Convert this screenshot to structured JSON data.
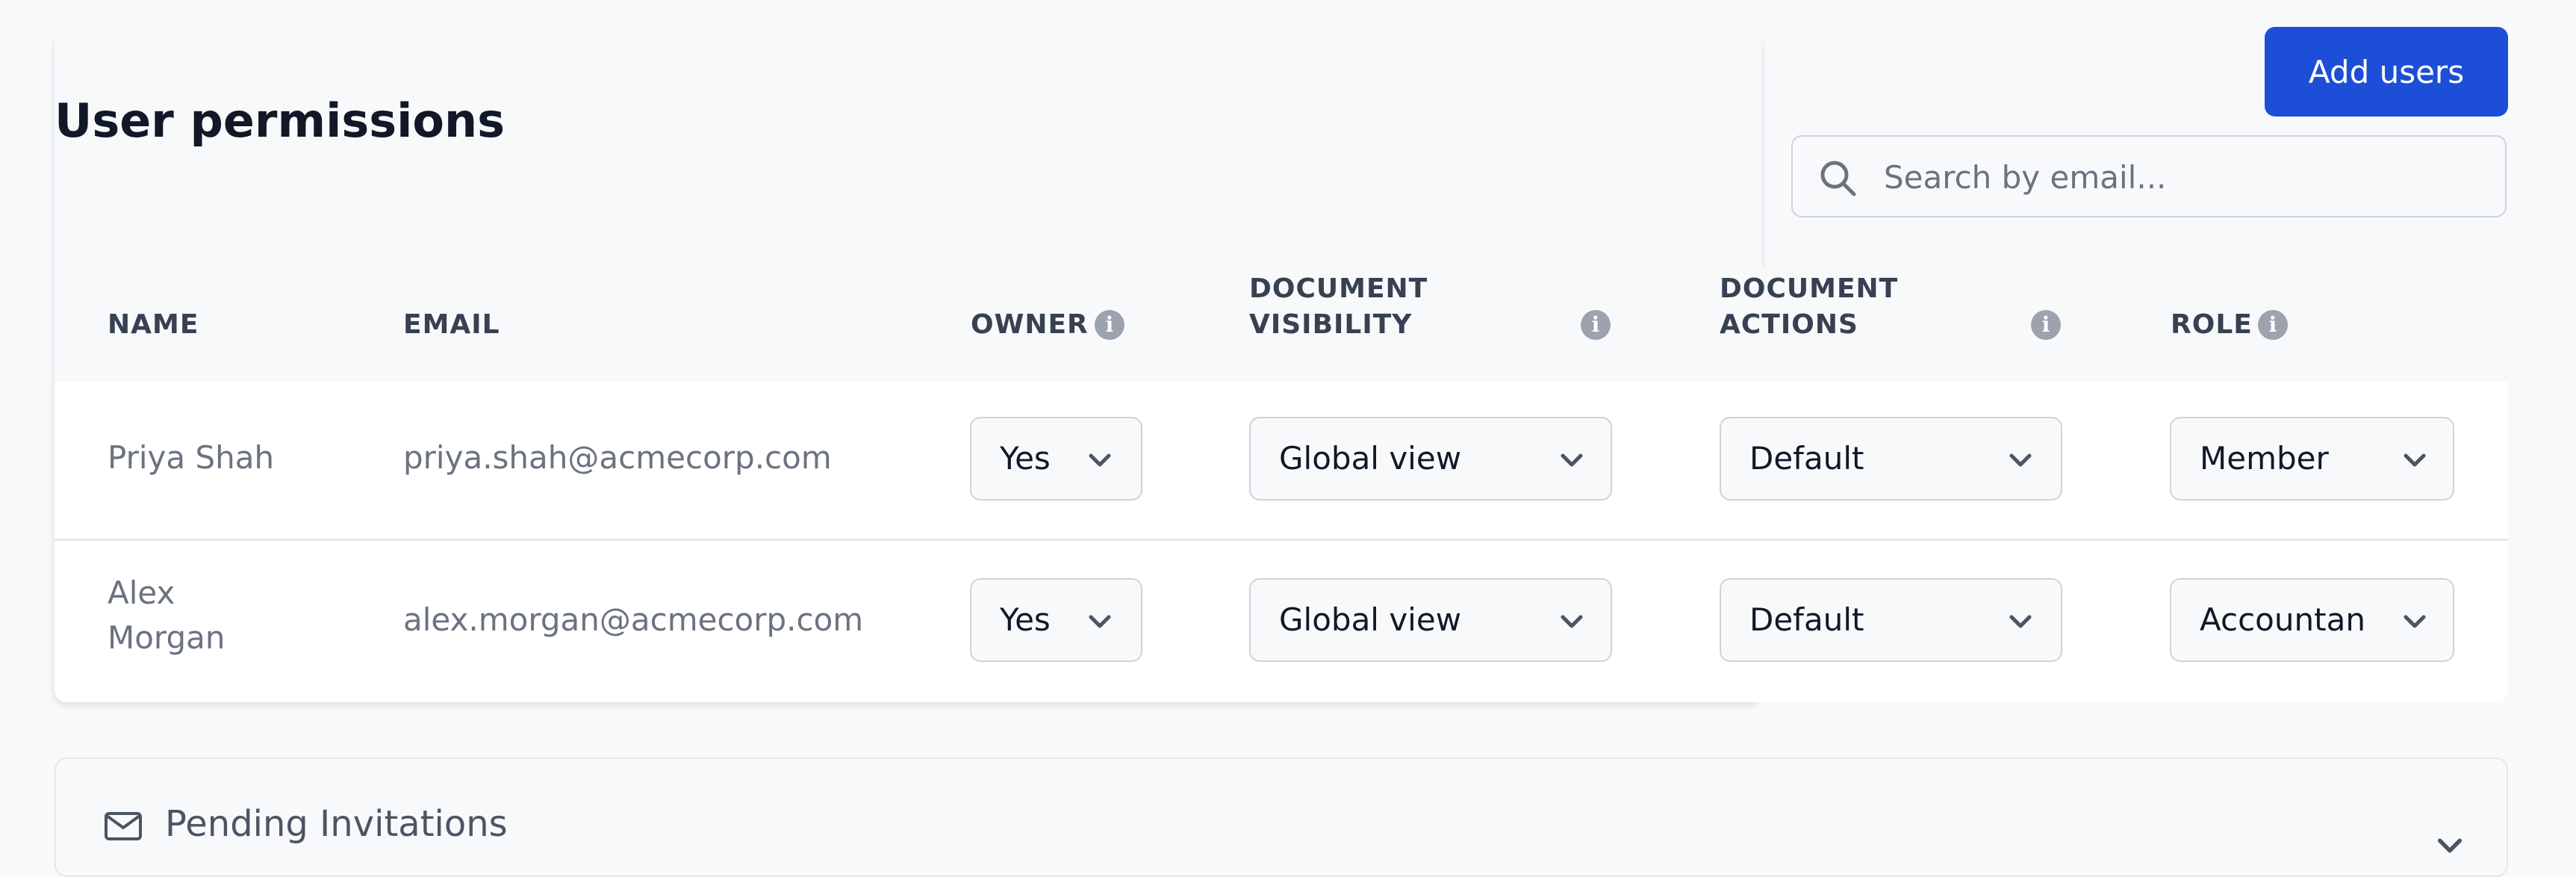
{
  "header": {
    "title": "User permissions",
    "add_users_label": "Add users"
  },
  "search": {
    "placeholder": "Search by email...",
    "icon": "search-icon"
  },
  "table": {
    "columns": {
      "name": "NAME",
      "email": "EMAIL",
      "owner": "OWNER",
      "doc_visibility_1": "DOCUMENT",
      "doc_visibility_2": "VISIBILITY",
      "doc_actions_1": "DOCUMENT",
      "doc_actions_2": "ACTIONS",
      "role": "ROLE"
    },
    "rows": [
      {
        "name": "Priya Shah",
        "email": "priya.shah@acmecorp.com",
        "owner": "Yes",
        "doc_visibility": "Global view",
        "doc_actions": "Default",
        "role": "Member"
      },
      {
        "name_line1": "Alex",
        "name_line2": "Morgan",
        "email": "alex.morgan@acmecorp.com",
        "owner": "Yes",
        "doc_visibility": "Global view",
        "doc_actions": "Default",
        "role": "Accountan"
      }
    ]
  },
  "pending": {
    "title": "Pending Invitations",
    "icon": "mail-icon"
  },
  "colors": {
    "accent": "#1d4ed8",
    "background": "#f8f9fb",
    "text_muted": "#6b7280",
    "heading": "#111827"
  }
}
